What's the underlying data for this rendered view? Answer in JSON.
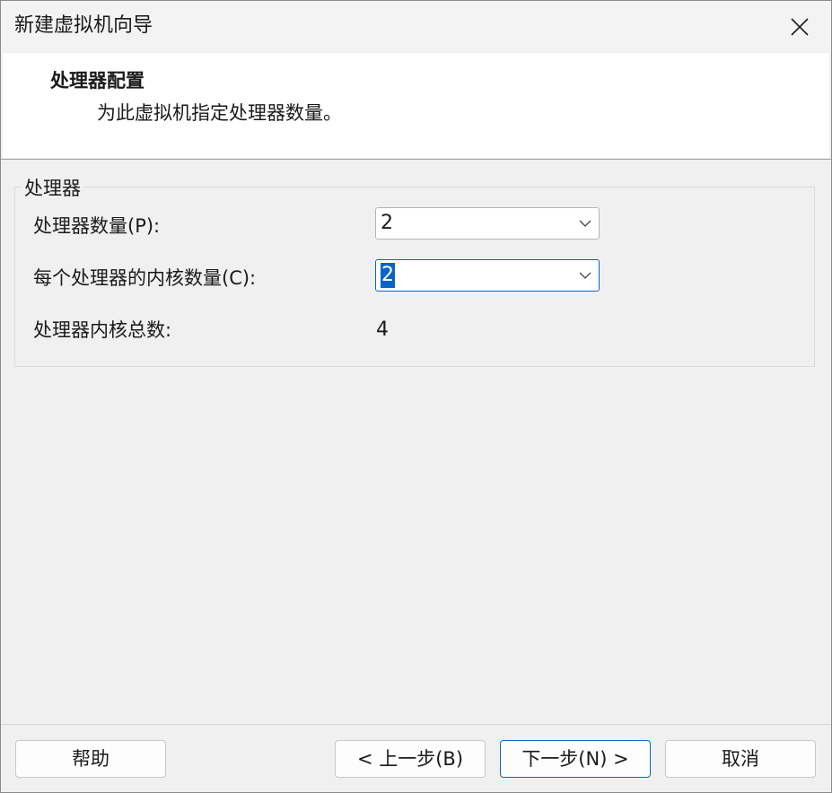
{
  "window": {
    "title": "新建虚拟机向导"
  },
  "header": {
    "title": "处理器配置",
    "subtitle": "为此虚拟机指定处理器数量。"
  },
  "processor_group": {
    "legend": "处理器",
    "processor_count": {
      "label": "处理器数量(P):",
      "value": "2"
    },
    "cores_per_processor": {
      "label": "每个处理器的内核数量(C):",
      "value": "2"
    },
    "total_cores": {
      "label": "处理器内核总数:",
      "value": "4"
    }
  },
  "footer": {
    "help_label": "帮助",
    "back_label": "< 上一步(B)",
    "next_label": "下一步(N) >",
    "cancel_label": "取消"
  },
  "icons": {
    "close": "close-icon",
    "dropdown": "chevron-down-icon"
  },
  "colors": {
    "accent": "#0a64c8",
    "header_bg": "#ffffff",
    "window_bg": "#f0f0f0"
  }
}
